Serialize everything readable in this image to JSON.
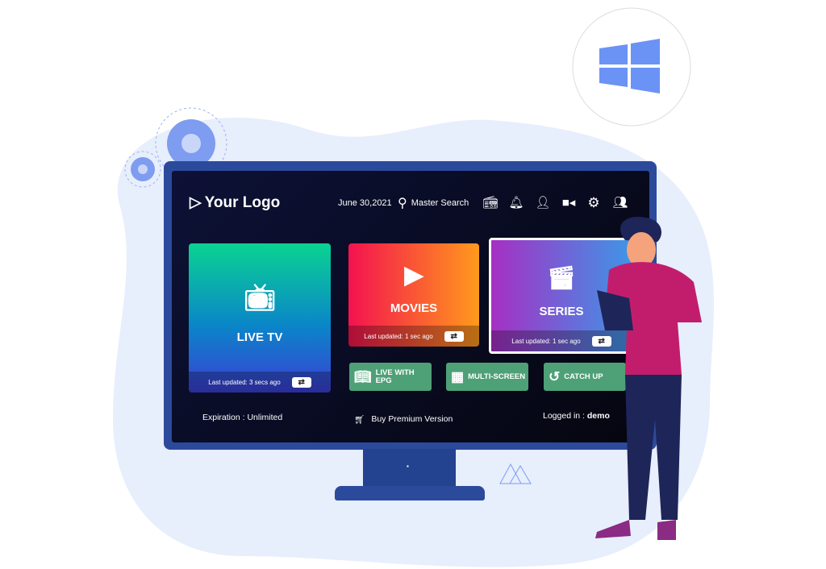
{
  "header": {
    "logo": "Your Logo",
    "date": "June 30,2021",
    "search_label": "Master Search",
    "icons": [
      "radio-icon",
      "bell-icon",
      "user-icon",
      "record-icon",
      "gear-icon",
      "switch-user-icon"
    ]
  },
  "cards": {
    "live_tv": {
      "title": "LIVE TV",
      "updated": "Last updated: 3 secs ago"
    },
    "movies": {
      "title": "MOVIES",
      "updated": "Last updated: 1 sec ago"
    },
    "series": {
      "title": "SERIES",
      "updated": "Last updated: 1 sec ago"
    }
  },
  "buttons": {
    "epg": "LIVE WITH EPG",
    "multiscreen": "MULTI-SCREEN",
    "catchup": "CATCH UP"
  },
  "footer": {
    "expiration": "Expiration : Unlimited",
    "premium": "Buy Premium Version",
    "logged_label": "Logged in : ",
    "user": "demo"
  },
  "colors": {
    "frame": "#2c4a9c",
    "screen": "#0d1136",
    "green": "#4ea077",
    "windows": "#6a93f5"
  }
}
